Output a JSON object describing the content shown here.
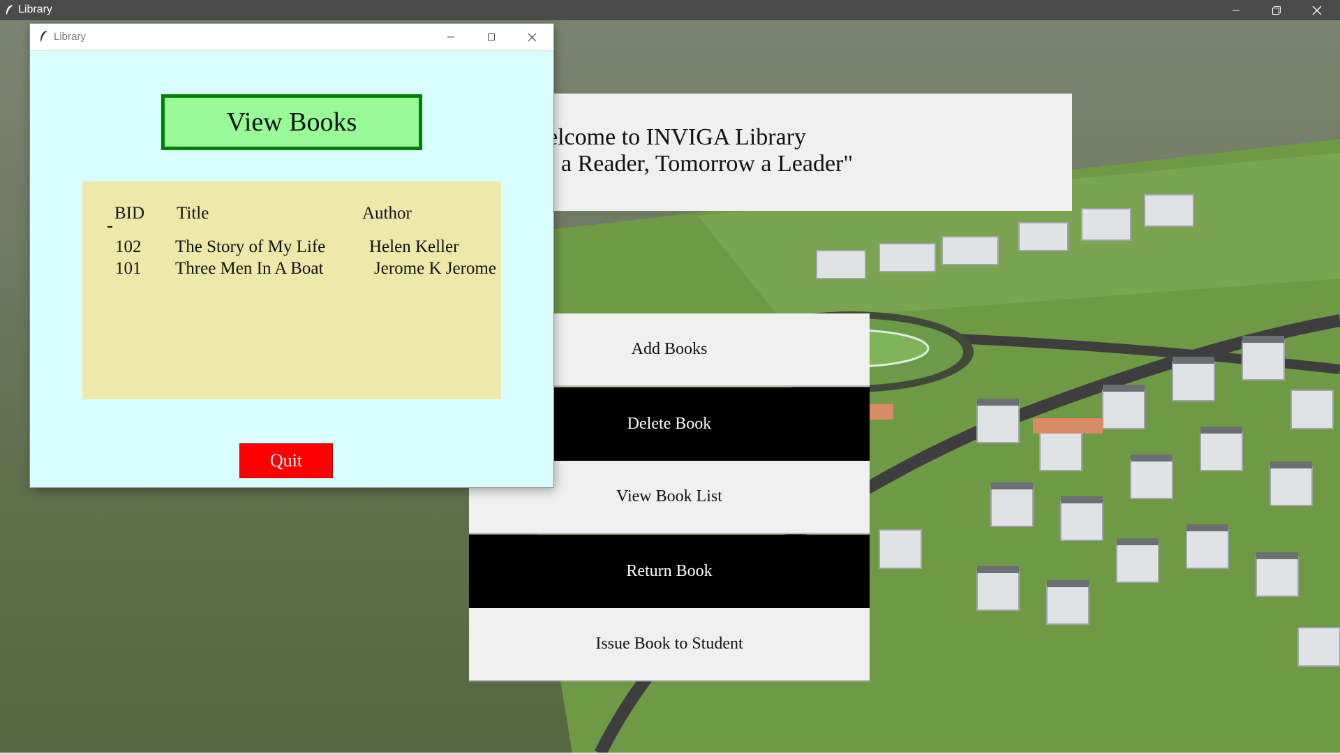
{
  "main_window": {
    "title": "Library",
    "welcome_line1": "elcome to INVIGA Library",
    "welcome_line2": "a Reader, Tomorrow a Leader\"",
    "menu": [
      {
        "label": "Add Books",
        "style": "light"
      },
      {
        "label": "Delete Book",
        "style": "dark"
      },
      {
        "label": "View Book List",
        "style": "light"
      },
      {
        "label": "Return Book",
        "style": "dark"
      },
      {
        "label": "Issue Book to Student",
        "style": "light"
      }
    ]
  },
  "child_window": {
    "title": "Library",
    "heading": "View Books",
    "table": {
      "headers": {
        "bid": "BID",
        "title": "Title",
        "author": "Author"
      },
      "rows": [
        {
          "bid": "102",
          "title": "The Story of My Life",
          "author": "Helen Keller"
        },
        {
          "bid": "101",
          "title": "Three Men In A Boat",
          "author": "Jerome K Jerome"
        }
      ]
    },
    "quit_label": "Quit"
  },
  "colors": {
    "child_bg": "#d8ffff",
    "heading_bg": "#98fb98",
    "heading_border": "#008000",
    "table_bg": "#eee8aa",
    "quit_bg": "#ff0000",
    "dark_button": "#000000",
    "light_button": "#f0f0f0"
  },
  "icons": [
    "feather-icon",
    "minimize-icon",
    "restore-icon",
    "maximize-icon",
    "close-icon"
  ]
}
